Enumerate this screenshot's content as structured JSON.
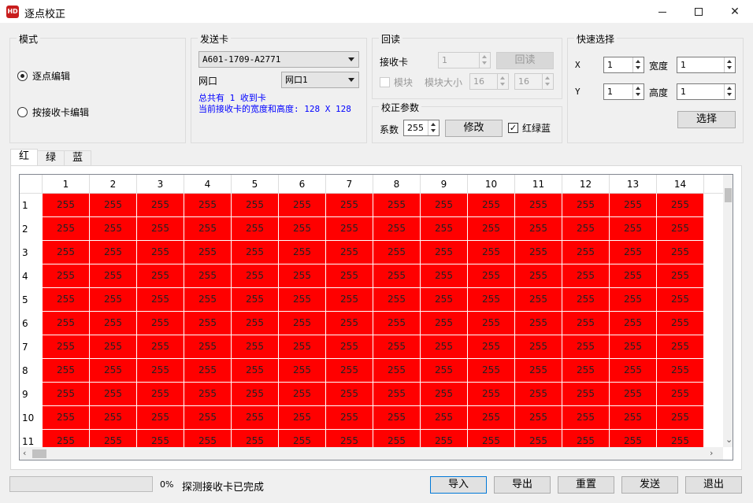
{
  "window": {
    "icon_text": "HD",
    "title": "逐点校正",
    "minimize_icon": "minimize-icon",
    "maximize_icon": "maximize-icon",
    "close_icon": "close-icon"
  },
  "mode": {
    "label": "模式",
    "options": [
      "逐点编辑",
      "按接收卡编辑"
    ],
    "selected": "逐点编辑"
  },
  "sender": {
    "label": "发送卡",
    "card_value": "A601-1709-A2771",
    "port_label": "网口",
    "port_value": "网口1",
    "info_line1": "总共有 1 收到卡",
    "info_line2": "当前接收卡的宽度和高度: 128 X 128"
  },
  "readback": {
    "label": "回读",
    "receiver_label": "接收卡",
    "receiver_value": "1",
    "readback_button": "回读",
    "module_label": "模块",
    "module_size_label": "模块大小",
    "module_w": "16",
    "module_h": "16"
  },
  "calib": {
    "label": "校正参数",
    "coef_label": "系数",
    "coef_value": "255",
    "modify_button": "修改",
    "rgb_label": "红绿蓝",
    "rgb_checked": true
  },
  "quick": {
    "label": "快速选择",
    "x_label": "X",
    "x_value": "1",
    "y_label": "Y",
    "y_value": "1",
    "w_label": "宽度",
    "w_value": "1",
    "h_label": "高度",
    "h_value": "1",
    "select_button": "选择"
  },
  "tabs": [
    "红",
    "绿",
    "蓝"
  ],
  "active_tab": "红",
  "grid": {
    "cell_color": "#ff0000",
    "columns": [
      "1",
      "2",
      "3",
      "4",
      "5",
      "6",
      "7",
      "8",
      "9",
      "10",
      "11",
      "12",
      "13",
      "14"
    ],
    "rows": [
      "1",
      "2",
      "3",
      "4",
      "5",
      "6",
      "7",
      "8",
      "9",
      "10",
      "11"
    ],
    "cell_value": "255"
  },
  "status": {
    "progress_percent": 0,
    "progress_text": "0%",
    "message": "探测接收卡已完成"
  },
  "buttons": {
    "import": "导入",
    "export": "导出",
    "reset": "重置",
    "send": "发送",
    "exit": "退出"
  }
}
